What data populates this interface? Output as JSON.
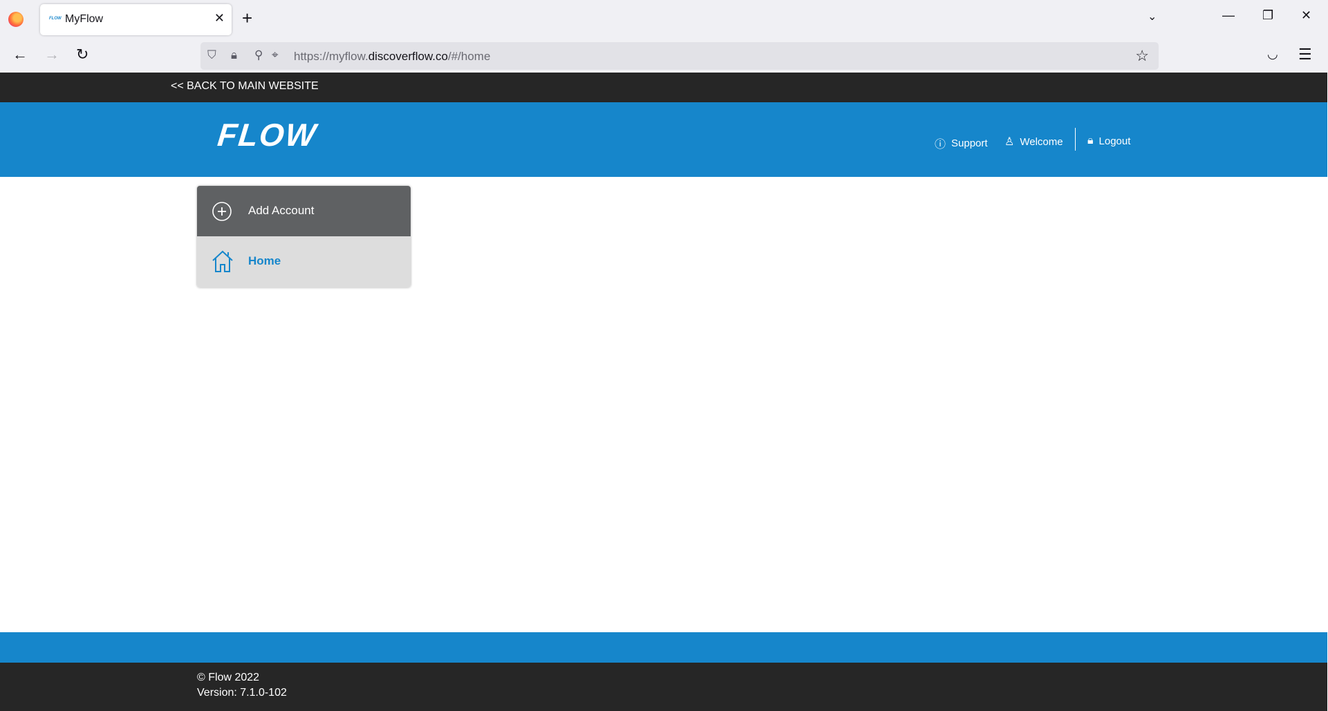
{
  "browser": {
    "tab_title": "MyFlow",
    "tab_favicon_text": "FLOW",
    "url_prefix": "https://myflow.",
    "url_domain": "discoverflow.co",
    "url_suffix": "/#/home"
  },
  "site": {
    "back_link": "<< BACK TO MAIN WEBSITE",
    "logo": "FLOW",
    "nav": {
      "support": "Support",
      "welcome": "Welcome",
      "logout": "Logout"
    },
    "menu": {
      "add_account": "Add Account",
      "home": "Home"
    },
    "footer": {
      "copyright": "© Flow 2022",
      "version": "Version: 7.1.0-102"
    },
    "colors": {
      "brand_blue": "#1686cb",
      "dark_bar": "#262626",
      "menu_dark": "#5f6163",
      "menu_light": "#dddddd"
    }
  }
}
